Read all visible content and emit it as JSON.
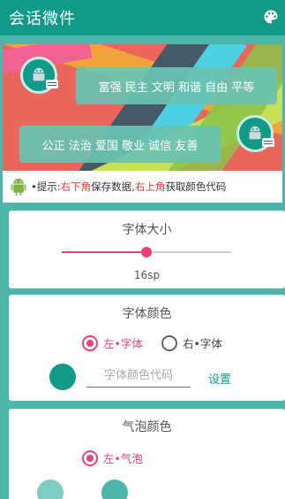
{
  "appbar": {
    "title": "会话微件",
    "palette_icon": "palette-icon"
  },
  "preview": {
    "bubble_top": "富强 民主 文明 和谐 自由 平等",
    "bubble_bottom": "公正 法治 爱国 敬业 诚信 友善",
    "bubble_color": "#69c3b2",
    "avatar_color": "#129a88"
  },
  "hint": {
    "prefix": "•提示:",
    "part1": "右下角",
    "part2": "保存数据,",
    "part3": "右上角",
    "part4": "获取颜色代码"
  },
  "font_size": {
    "title": "字体大小",
    "value_label": "16sp",
    "level": 0.5
  },
  "font_color": {
    "title": "字体颜色",
    "option_left": "左•字体",
    "option_right": "右•字体",
    "selected": "left",
    "swatch_color": "#129a88",
    "input_placeholder": "字体颜色代码",
    "set_label": "设置"
  },
  "bubble_color": {
    "title": "气泡颜色",
    "option_left": "左•气泡",
    "swatch_left": "#7ecdc2",
    "swatch_right": "#4db6a8"
  },
  "colors": {
    "accent": "#ec407a",
    "primary": "#129a88",
    "background": "#4db6a8"
  }
}
